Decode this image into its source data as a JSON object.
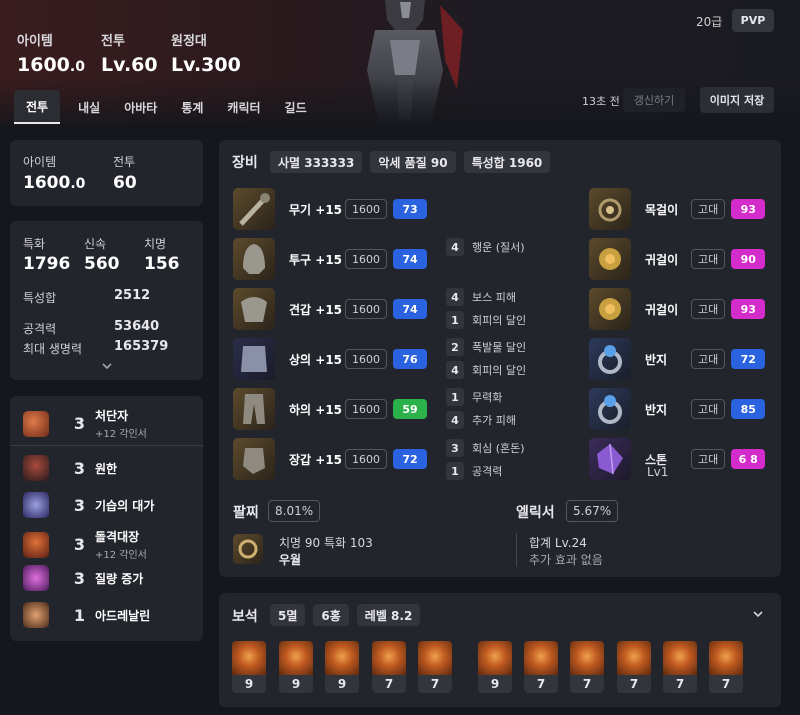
{
  "header": {
    "stats": [
      {
        "label": "아이템",
        "value_main": "1600",
        "value_dec": ".0"
      },
      {
        "label": "전투",
        "value_main": "Lv.60",
        "value_dec": ""
      },
      {
        "label": "원정대",
        "value_main": "Lv.300",
        "value_dec": ""
      }
    ],
    "level_text": "20급",
    "pvp_label": "PVP",
    "tabs": [
      "전투",
      "내실",
      "아바타",
      "통계",
      "캐릭터",
      "길드"
    ],
    "updated_ago": "13초 전",
    "refresh_label": "갱신하기",
    "save_image_label": "이미지 저장"
  },
  "summary": {
    "item_label": "아이템",
    "item_main": "1600",
    "item_dec": ".0",
    "combat_label": "전투",
    "combat_value": "60"
  },
  "stats": {
    "crit_spec": [
      {
        "label": "특화",
        "value": "1796"
      },
      {
        "label": "신속",
        "value": "560"
      },
      {
        "label": "치명",
        "value": "156"
      }
    ],
    "sum_label": "특성합",
    "sum_value": "2512",
    "attack_label": "공격력",
    "attack_value": "53640",
    "hp_label": "최대 생명력",
    "hp_value": "165379",
    "expand_icon": "chevron-down"
  },
  "engravings": [
    {
      "level": "3",
      "name": "처단자",
      "sub": "+12 각인서",
      "color": "#c2502c"
    },
    {
      "level": "3",
      "name": "원한",
      "sub": "",
      "color": "#7a3b33"
    },
    {
      "level": "3",
      "name": "기습의 대가",
      "sub": "",
      "color": "#4b3f8a"
    },
    {
      "level": "3",
      "name": "돌격대장",
      "sub": "+12 각인서",
      "color": "#b34a24"
    },
    {
      "level": "3",
      "name": "질량 증가",
      "sub": "",
      "color": "#8a3c8f"
    },
    {
      "level": "1",
      "name": "아드레날린",
      "sub": "",
      "color": "#a25a3a"
    }
  ],
  "equipment": {
    "title": "장비",
    "chips": [
      "사멸 333333",
      "악세 품질 90",
      "특성합 1960"
    ],
    "gear": [
      {
        "name": "무기 +15",
        "ilvl": "1600",
        "quality": "73",
        "qcolor": "blue"
      },
      {
        "name": "투구 +15",
        "ilvl": "1600",
        "quality": "74",
        "qcolor": "blue"
      },
      {
        "name": "견갑 +15",
        "ilvl": "1600",
        "quality": "74",
        "qcolor": "blue"
      },
      {
        "name": "상의 +15",
        "ilvl": "1600",
        "quality": "76",
        "qcolor": "blue"
      },
      {
        "name": "하의 +15",
        "ilvl": "1600",
        "quality": "59",
        "qcolor": "green"
      },
      {
        "name": "장갑 +15",
        "ilvl": "1600",
        "quality": "72",
        "qcolor": "blue"
      }
    ],
    "effects": [
      {
        "n": "4",
        "t": "행운 (질서)"
      },
      {
        "n": "4",
        "t": "보스 피해"
      },
      {
        "n": "1",
        "t": "회피의 달인"
      },
      {
        "n": "2",
        "t": "폭발물 달인"
      },
      {
        "n": "4",
        "t": "회피의 달인"
      },
      {
        "n": "1",
        "t": "무력화"
      },
      {
        "n": "4",
        "t": "추가 피해"
      },
      {
        "n": "3",
        "t": "회심 (혼돈)"
      },
      {
        "n": "1",
        "t": "공격력"
      }
    ],
    "accessories": [
      {
        "name": "목걸이",
        "grade": "고대",
        "quality": "93",
        "qcolor": "pink"
      },
      {
        "name": "귀걸이",
        "grade": "고대",
        "quality": "90",
        "qcolor": "pink"
      },
      {
        "name": "귀걸이",
        "grade": "고대",
        "quality": "93",
        "qcolor": "pink"
      },
      {
        "name": "반지",
        "grade": "고대",
        "quality": "72",
        "qcolor": "blue"
      },
      {
        "name": "반지",
        "grade": "고대",
        "quality": "85",
        "qcolor": "blue"
      },
      {
        "name": "스톤",
        "grade": "고대",
        "quality": "6 8",
        "qcolor": "pink",
        "sub": "Lv1"
      }
    ],
    "bracelet": {
      "label": "팔찌",
      "percent": "8.01%",
      "line1": "치명 90  특화 103",
      "line2": "우월"
    },
    "elixir": {
      "label": "엘릭서",
      "percent": "5.67%",
      "line1": "합계 Lv.24",
      "line2": "추가 효과 없음"
    }
  },
  "gems": {
    "title": "보석",
    "chips": [
      "5멸",
      "6홍",
      "레벨 8.2"
    ],
    "levels": [
      "9",
      "9",
      "9",
      "7",
      "7",
      "9",
      "7",
      "7",
      "7",
      "7",
      "7"
    ]
  },
  "colors": {
    "bg": "#15171c",
    "panel": "#23252c",
    "quality_blue": "#2a62e0",
    "quality_green": "#2bb24a",
    "quality_pink": "#d42bcb"
  }
}
